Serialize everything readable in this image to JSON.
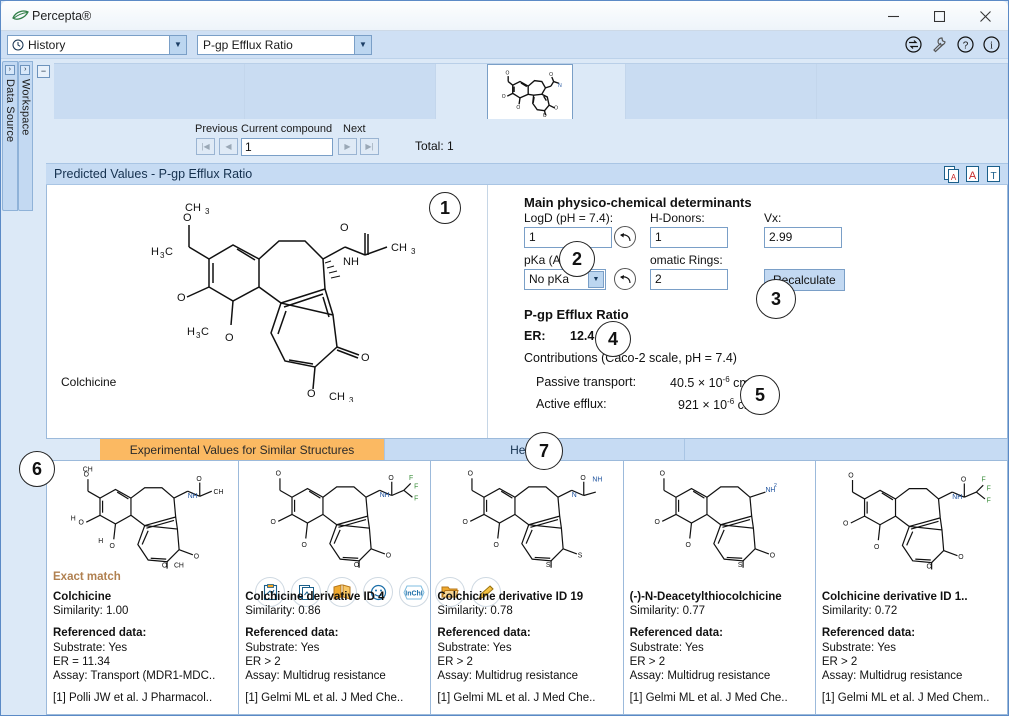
{
  "window": {
    "title": "Percepta®",
    "logo_icon": "leaf-icon",
    "minimize_icon": "minimize-icon",
    "maximize_icon": "maximize-icon",
    "close_icon": "close-icon"
  },
  "toolbar": {
    "history_combo": {
      "value": "History",
      "icon": "clock-icon"
    },
    "model_combo": {
      "value": "P-gp Efflux Ratio"
    },
    "icons": [
      {
        "name": "sync-icon"
      },
      {
        "name": "wrench-icon"
      },
      {
        "name": "help-icon"
      },
      {
        "name": "info-icon"
      }
    ]
  },
  "dock": {
    "tabs": [
      {
        "label": "Data Source",
        "pin_icon": "chevron-right-icon"
      },
      {
        "label": "Workspace",
        "pin_icon": "chevron-right-icon"
      }
    ]
  },
  "strip": {
    "collapse_icon": "minus-icon",
    "cells": 5,
    "selected_index": 2
  },
  "nav": {
    "previous_label": "Previous",
    "current_label": "Current compound",
    "next_label": "Next",
    "first_icon": "first-page-icon",
    "prev_icon": "prev-icon",
    "next_icon": "next-icon",
    "last_icon": "last-page-icon",
    "current_value": "1",
    "total_label": "Total: 1"
  },
  "predicted_panel": {
    "title": "Predicted Values - P-gp Efflux Ratio",
    "export_icons": [
      {
        "name": "export-pdf-multi-icon"
      },
      {
        "name": "export-pdf-icon"
      },
      {
        "name": "export-text-icon"
      }
    ],
    "molecule_caption": "Colchicine",
    "structure_buttons": [
      {
        "name": "copy-structure-icon"
      },
      {
        "name": "copy-structures-icon"
      },
      {
        "name": "dictionary-icon"
      },
      {
        "name": "smiley-icon"
      },
      {
        "name": "inchi-icon"
      },
      {
        "name": "open-folder-icon"
      },
      {
        "name": "edit-pencil-icon"
      }
    ]
  },
  "determinants": {
    "heading": "Main physico-chemical determinants",
    "logd_label": "LogD (pH = 7.4):",
    "logd_value": "1",
    "hdonors_label": "H-Donors:",
    "hdonors_value": "1",
    "vx_label": "Vx:",
    "vx_value": "2.99",
    "pka_label": "pKa (Acid):",
    "pka_value": "No pKa",
    "rings_label": "omatic Rings:",
    "rings_value": "2",
    "undo_icon": "undo-arrow-icon",
    "recalculate_label": "Recalculate"
  },
  "results": {
    "title": "P-gp Efflux Ratio",
    "er_label": "ER:",
    "er_value": "12.4",
    "contributions_label": "Contributions (Caco-2 scale, pH = 7.4)",
    "passive_label": "Passive transport:",
    "passive_value": "40.5",
    "passive_exp": "-6",
    "passive_unit": "cm/s",
    "active_label": "Active efflux:",
    "active_value": "921",
    "active_exp": "-6",
    "active_unit": "cm/s",
    "times_symbol": "×",
    "base_symbol": "10"
  },
  "tabs": [
    {
      "label": "Experimental Values for Similar Structures",
      "active": true
    },
    {
      "label": "Heatmap",
      "active": false
    },
    {
      "label": "",
      "active": false
    }
  ],
  "cards": [
    {
      "badge": "Exact match",
      "name": "Colchicine",
      "similarity": "Similarity: 1.00",
      "ref_header": "Referenced data:",
      "substrate": "Substrate: Yes",
      "er": "ER = 11.34",
      "assay": "Assay: Transport (MDR1-MDC..",
      "citation": "[1] Polli JW et al. J Pharmacol.."
    },
    {
      "badge": "",
      "name": "Colchicine derivative ID 4",
      "similarity": "Similarity: 0.86",
      "ref_header": "Referenced data:",
      "substrate": "Substrate: Yes",
      "er": "ER > 2",
      "assay": "Assay: Multidrug resistance",
      "citation": "[1] Gelmi ML et al. J Med Che.."
    },
    {
      "badge": "",
      "name": "Colchicine derivative ID 19",
      "similarity": "Similarity: 0.78",
      "ref_header": "Referenced data:",
      "substrate": "Substrate: Yes",
      "er": "ER > 2",
      "assay": "Assay: Multidrug resistance",
      "citation": "[1] Gelmi ML et al. J Med Che.."
    },
    {
      "badge": "",
      "name": "(-)-N-Deacetylthiocolchicine",
      "similarity": "Similarity: 0.77",
      "ref_header": "Referenced data:",
      "substrate": "Substrate: Yes",
      "er": "ER > 2",
      "assay": "Assay: Multidrug resistance",
      "citation": "[1] Gelmi ML et al. J Med Che.."
    },
    {
      "badge": "",
      "name": "Colchicine derivative ID 1..",
      "similarity": "Similarity: 0.72",
      "ref_header": "Referenced data:",
      "substrate": "Substrate: Yes",
      "er": "ER > 2",
      "assay": "Assay: Multidrug resistance",
      "citation": "[1] Gelmi ML et al. J Med Chem.."
    }
  ],
  "annotations": [
    {
      "id": "1",
      "label": "1"
    },
    {
      "id": "2",
      "label": "2"
    },
    {
      "id": "3",
      "label": "3"
    },
    {
      "id": "4",
      "label": "4"
    },
    {
      "id": "5",
      "label": "5"
    },
    {
      "id": "6",
      "label": "6"
    },
    {
      "id": "7",
      "label": "7"
    }
  ],
  "colors": {
    "accent_orange": "#fbb962",
    "panel_blue": "#c6dbf3",
    "background": "#dce9f7",
    "border": "#9cbadb"
  }
}
